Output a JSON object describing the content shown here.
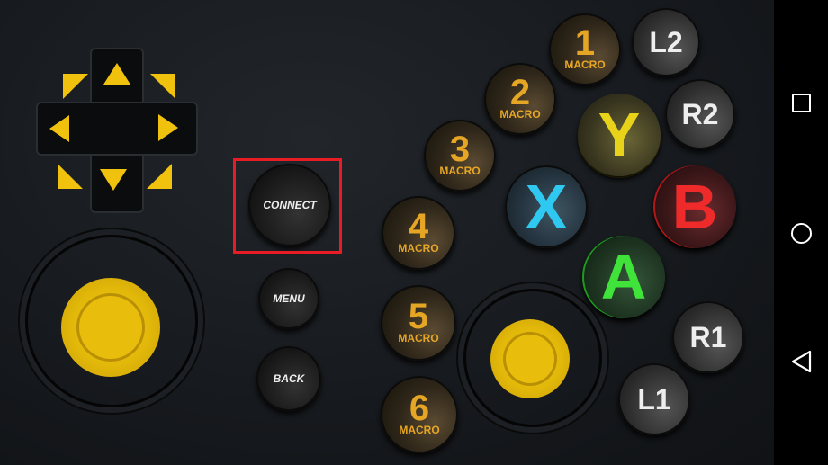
{
  "macros": [
    {
      "num": "1",
      "label": "MACRO"
    },
    {
      "num": "2",
      "label": "MACRO"
    },
    {
      "num": "3",
      "label": "MACRO"
    },
    {
      "num": "4",
      "label": "MACRO"
    },
    {
      "num": "5",
      "label": "MACRO"
    },
    {
      "num": "6",
      "label": "MACRO"
    }
  ],
  "shoulders": {
    "l2": "L2",
    "r2": "R2",
    "r1": "R1",
    "l1": "L1"
  },
  "face": {
    "y": "Y",
    "x": "X",
    "b": "B",
    "a": "A"
  },
  "face_colors": {
    "y": "#e8d21a",
    "x": "#2ec8f0",
    "b": "#ee2a2a",
    "a": "#3fe33a"
  },
  "center": {
    "connect": "CONNECT",
    "menu": "MENU",
    "back": "BACK"
  },
  "accent": "#f0c20e",
  "highlight_color": "#e81c24",
  "nav": {
    "icons": [
      "square-icon",
      "circle-icon",
      "triangle-icon"
    ]
  }
}
